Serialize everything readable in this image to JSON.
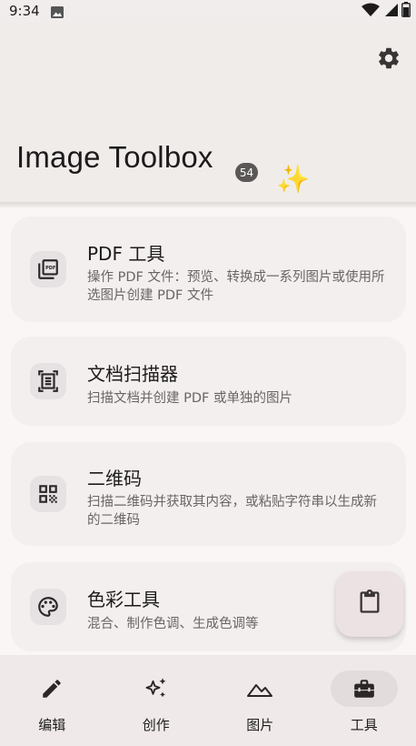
{
  "status_bar": {
    "time": "9:34",
    "icons": [
      "gallery-icon",
      "wifi-icon",
      "signal-icon",
      "battery-icon"
    ]
  },
  "header": {
    "title": "Image Toolbox",
    "version_badge": "54",
    "sparkle": "✨",
    "settings_icon": "gear-icon"
  },
  "tools": [
    {
      "icon": "pdf-icon",
      "title": "PDF 工具",
      "description": "操作 PDF 文件：预览、转换成一系列图片或使用所选图片创建 PDF 文件"
    },
    {
      "icon": "document-scanner-icon",
      "title": "文档扫描器",
      "description": "扫描文档并创建 PDF 或单独的图片"
    },
    {
      "icon": "qr-code-icon",
      "title": "二维码",
      "description": "扫描二维码并获取其内容，或粘贴字符串以生成新的二维码"
    },
    {
      "icon": "palette-icon",
      "title": "色彩工具",
      "description": "混合、制作色调、生成色调等"
    }
  ],
  "fab": {
    "icon": "clipboard-icon"
  },
  "bottom_nav": [
    {
      "icon": "pencil-icon",
      "label": "编辑",
      "active": false
    },
    {
      "icon": "sparkles-icon",
      "label": "创作",
      "active": false
    },
    {
      "icon": "landscape-icon",
      "label": "图片",
      "active": false
    },
    {
      "icon": "toolbox-icon",
      "label": "工具",
      "active": true
    }
  ],
  "colors": {
    "background": "#f1edec",
    "card": "#f3efee",
    "icon_container": "#e6e1e2",
    "badge": "#5b5757",
    "fab": "#ece1e3",
    "nav_active_pill": "#e2dcdc"
  }
}
